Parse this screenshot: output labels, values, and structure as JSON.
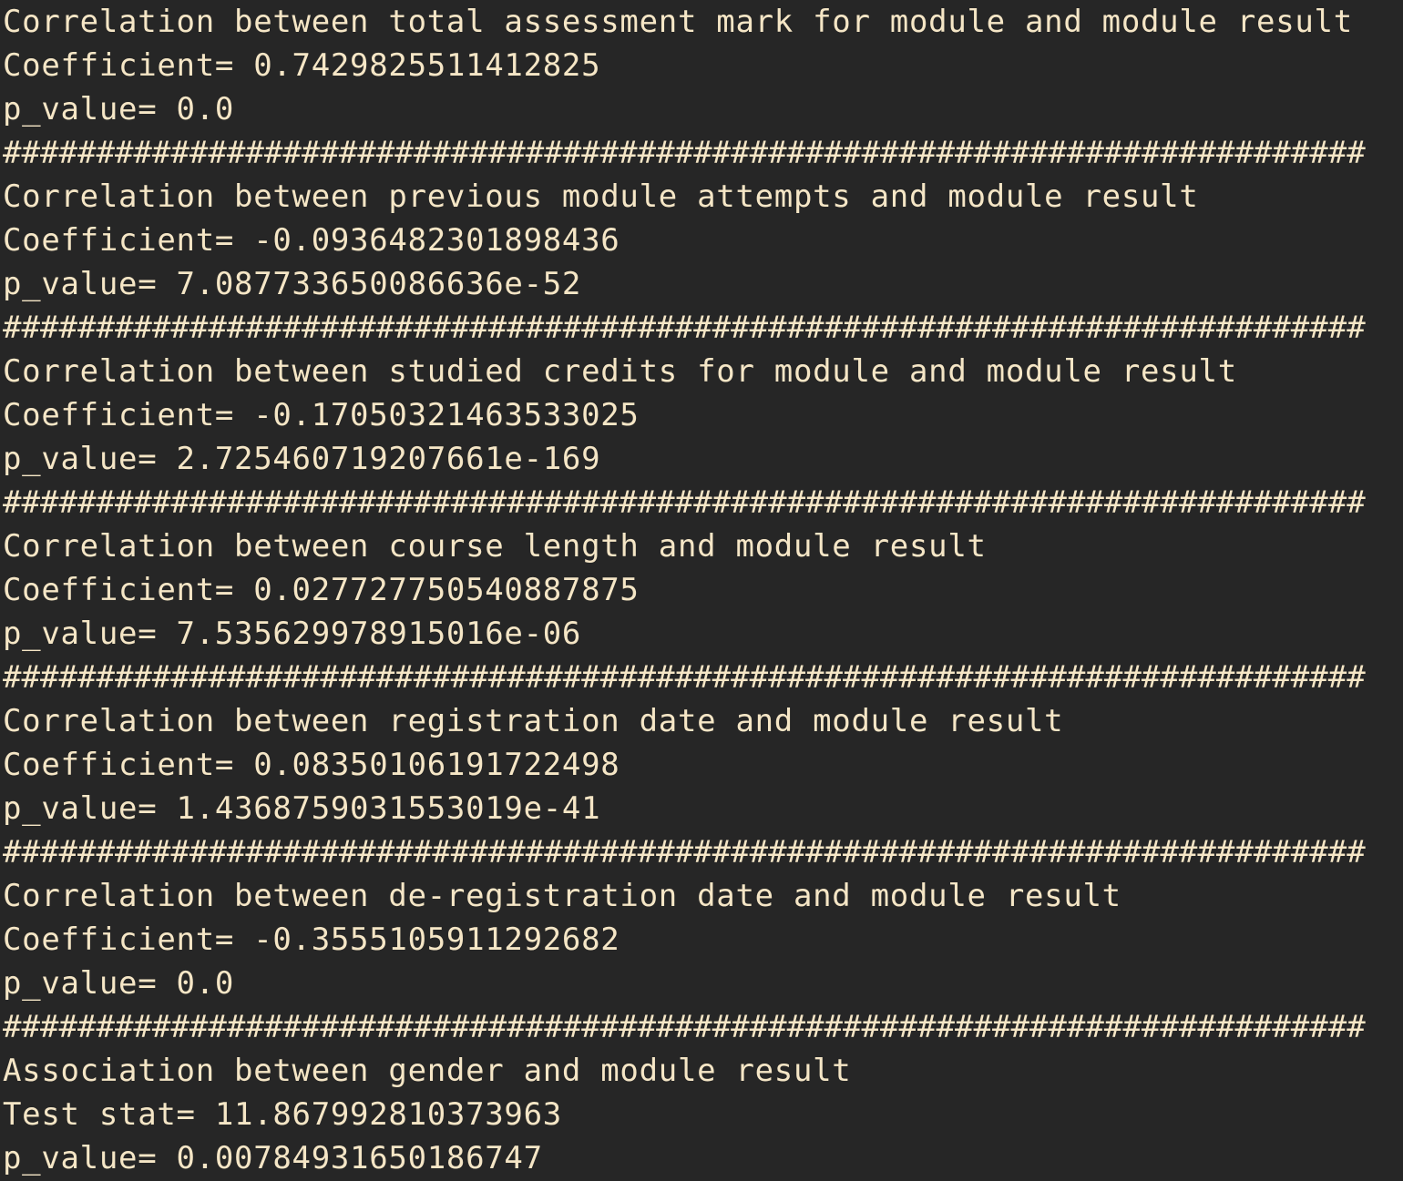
{
  "colors": {
    "background": "#262626",
    "text": "#f5e6c6"
  },
  "separator": "#########################################################################",
  "lines": [
    "Correlation between total assessment mark for module and module result",
    "Coefficient= 0.7429825511412825",
    "p_value= 0.0",
    "#########################################################################",
    "Correlation between previous module attempts and module result",
    "Coefficient= -0.0936482301898436",
    "p_value= 7.087733650086636e-52",
    "#########################################################################",
    "Correlation between studied credits for module and module result",
    "Coefficient= -0.17050321463533025",
    "p_value= 2.725460719207661e-169",
    "#########################################################################",
    "Correlation between course length and module result",
    "Coefficient= 0.027727750540887875",
    "p_value= 7.535629978915016e-06",
    "#########################################################################",
    "Correlation between registration date and module result",
    "Coefficient= 0.08350106191722498",
    "p_value= 1.4368759031553019e-41",
    "#########################################################################",
    "Correlation between de-registration date and module result",
    "Coefficient= -0.3555105911292682",
    "p_value= 0.0",
    "#########################################################################",
    "Association between gender and module result",
    "Test stat= 11.867992810373963",
    "p_value= 0.00784931650186747"
  ]
}
